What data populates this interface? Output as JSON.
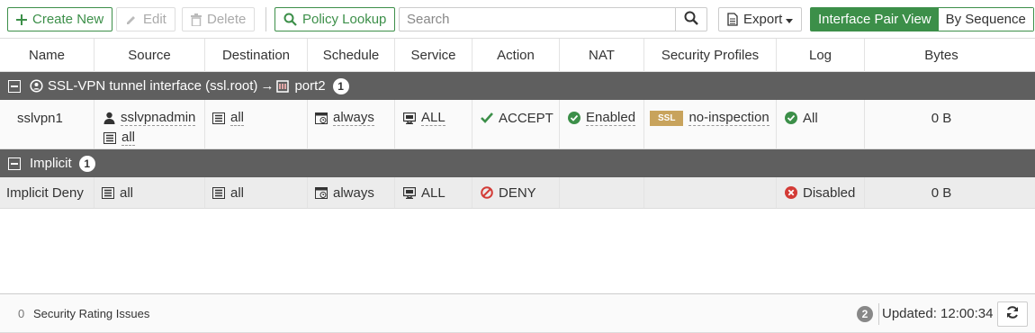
{
  "toolbar": {
    "create_new": "Create New",
    "edit": "Edit",
    "delete": "Delete",
    "policy_lookup": "Policy Lookup",
    "search_placeholder": "Search",
    "export": "Export",
    "view_interface_pair": "Interface Pair View",
    "view_by_sequence": "By Sequence",
    "active_view": "Interface Pair View"
  },
  "columns": [
    "Name",
    "Source",
    "Destination",
    "Schedule",
    "Service",
    "Action",
    "NAT",
    "Security Profiles",
    "Log",
    "Bytes"
  ],
  "groups": [
    {
      "label_left": "SSL-VPN tunnel interface (ssl.root)",
      "arrow": "→",
      "label_right": "port2",
      "count": "1",
      "policies": [
        {
          "name": "sslvpn1",
          "source": [
            "sslvpnadmin",
            "all"
          ],
          "destination": "all",
          "schedule": "always",
          "service": "ALL",
          "action": "ACCEPT",
          "nat": "Enabled",
          "security_profile_badge": "SSL",
          "security_profile": "no-inspection",
          "log": "All",
          "bytes": "0 B"
        }
      ]
    },
    {
      "label_left": "Implicit",
      "count": "1",
      "policies": [
        {
          "name": "Implicit Deny",
          "source": [
            "all"
          ],
          "destination": "all",
          "schedule": "always",
          "service": "ALL",
          "action": "DENY",
          "nat": "",
          "security_profile": "",
          "log": "Disabled",
          "bytes": "0 B"
        }
      ]
    }
  ],
  "footer": {
    "security_rating_count": "0",
    "security_rating_label": "Security Rating Issues",
    "notifications_count": "2",
    "updated": "Updated: 12:00:34"
  },
  "colors": {
    "accent_green": "#3c8f49",
    "group_header_bg": "#5f5f5f",
    "deny_red": "#d33b36",
    "ssl_badge": "#c8a35c"
  }
}
